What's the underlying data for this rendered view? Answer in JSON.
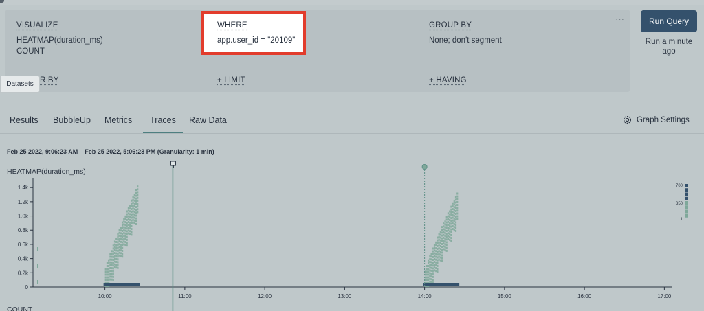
{
  "query": {
    "visualize": {
      "label": "VISUALIZE",
      "items": [
        "HEATMAP(duration_ms)",
        "COUNT"
      ]
    },
    "where": {
      "label": "WHERE",
      "clause": "app.user_id = \"20109\""
    },
    "group_by": {
      "label": "GROUP BY",
      "value": "None; don't segment"
    },
    "order_by": {
      "label": "ORDER BY"
    },
    "limit": {
      "label": "+ LIMIT"
    },
    "having": {
      "label": "+ HAVING"
    },
    "menu_icon": "more-dots-icon"
  },
  "run": {
    "button_label": "Run Query",
    "last_run": "Run a minute ago"
  },
  "datasets_tab": "Datasets",
  "tabs": [
    {
      "label": "Results",
      "active": false
    },
    {
      "label": "BubbleUp",
      "active": false
    },
    {
      "label": "Metrics",
      "active": false
    },
    {
      "label": "Traces",
      "active": true
    },
    {
      "label": "Raw Data",
      "active": false
    }
  ],
  "graph_settings": {
    "label": "Graph Settings",
    "icon": "gear-icon"
  },
  "time_range": "Feb 25 2022, 9:06:23 AM – Feb 25 2022, 5:06:23 PM (Granularity: 1 min)",
  "chart_data": {
    "type": "heatmap",
    "title": "HEATMAP(duration_ms)",
    "second_chart_title": "COUNT",
    "x_ticks": [
      "10:00",
      "11:00",
      "12:00",
      "13:00",
      "14:00",
      "15:00",
      "16:00",
      "17:00"
    ],
    "y_ticks": [
      "0",
      "0.2k",
      "0.4k",
      "0.6k",
      "0.8k",
      "1.0k",
      "1.2k",
      "1.4k"
    ],
    "ylim": [
      0,
      1450
    ],
    "xlim_hours": [
      9.1,
      17.1
    ],
    "clusters": [
      {
        "start_hour": 10.0,
        "end_hour": 10.4,
        "min_ms": 0,
        "max_ms": 1400
      },
      {
        "start_hour": 14.0,
        "end_hour": 14.4,
        "min_ms": 0,
        "max_ms": 1300
      }
    ],
    "markers": [
      {
        "hour": 10.85,
        "kind": "pin"
      },
      {
        "hour": 14.0,
        "kind": "dot"
      }
    ],
    "legend_ticks": [
      "700",
      "350",
      "1"
    ],
    "colors": {
      "cell": "#7fa89a",
      "axis": "#2a3340",
      "marker": "#5d8f86",
      "legend_high": "#34516c",
      "legend_low": "#7fa89a"
    }
  }
}
